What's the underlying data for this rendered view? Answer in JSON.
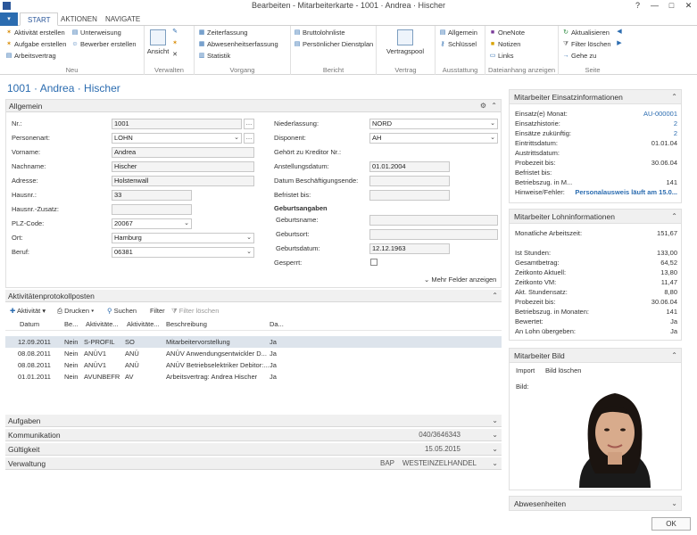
{
  "window": {
    "title": "Bearbeiten - Mitarbeiterkarte - 1001 · Andrea · Hischer",
    "help": "?",
    "minimize": "—",
    "maximize": "□",
    "close": "✕"
  },
  "tabs": [
    "START",
    "AKTIONEN",
    "NAVIGATE"
  ],
  "ribbon": {
    "neu": {
      "label": "Neu",
      "items": [
        "Aktivität erstellen",
        "Aufgabe erstellen",
        "Arbeitsvertrag",
        "Unterweisung",
        "Bewerber erstellen"
      ]
    },
    "verwalten": {
      "label": "Verwalten",
      "ansicht": "Ansicht"
    },
    "vorgang": {
      "label": "Vorgang",
      "items": [
        "Zeiterfassung",
        "Abwesenheitserfassung",
        "Statistik"
      ]
    },
    "bericht": {
      "label": "Bericht",
      "items": [
        "Bruttolohnliste",
        "Persönlicher Dienstplan"
      ]
    },
    "vertrag": {
      "label": "Vertrag",
      "vertragspool": "Vertragspool"
    },
    "ausstattung": {
      "label": "Ausstattung",
      "items": [
        "Allgemein",
        "Schlüssel"
      ]
    },
    "dateianhang": {
      "label": "Dateianhang anzeigen",
      "items": [
        "OneNote",
        "Notizen",
        "Links"
      ]
    },
    "seite": {
      "label": "Seite",
      "items": [
        "Aktualisieren",
        "Filter löschen",
        "Gehe zu"
      ]
    }
  },
  "page_title": "1001 · Andrea · Hischer",
  "allgemein": {
    "title": "Allgemein",
    "left": [
      {
        "label": "Nr.:",
        "value": "1001"
      },
      {
        "label": "Personenart:",
        "value": "LOHN"
      },
      {
        "label": "Vorname:",
        "value": "Andrea"
      },
      {
        "label": "Nachname:",
        "value": "Hischer"
      },
      {
        "label": "Adresse:",
        "value": "Holstenwall"
      },
      {
        "label": "Hausnr.:",
        "value": "33"
      },
      {
        "label": "Hausnr.-Zusatz:",
        "value": ""
      },
      {
        "label": "PLZ-Code:",
        "value": "20067"
      },
      {
        "label": "Ort:",
        "value": "Hamburg"
      },
      {
        "label": "Beruf:",
        "value": "06381"
      }
    ],
    "right": {
      "niederlassung": {
        "label": "Niederlassung:",
        "value": "NORD"
      },
      "disponent": {
        "label": "Disponent:",
        "value": "AH"
      },
      "kreditor": {
        "label": "Gehört zu Kreditor Nr.:"
      },
      "anstellung": {
        "label": "Anstellungsdatum:",
        "value": "01.01.2004"
      },
      "ende": {
        "label": "Datum Beschäftigungsende:",
        "value": ""
      },
      "befristet": {
        "label": "Befristet bis:",
        "value": ""
      },
      "geburt_head": "Geburtsangaben",
      "geburtsname": {
        "label": "Geburtsname:",
        "value": ""
      },
      "geburtsort": {
        "label": "Geburtsort:",
        "value": ""
      },
      "geburtsdatum": {
        "label": "Geburtsdatum:",
        "value": "12.12.1963"
      },
      "gesperrt": {
        "label": "Gesperrt:"
      }
    },
    "more": "Mehr Felder anzeigen"
  },
  "activities": {
    "title": "Aktivitätenprotokollposten",
    "toolbar": [
      "Aktivität",
      "Drucken",
      "Suchen",
      "Filter",
      "Filter löschen"
    ],
    "columns": [
      "Datum",
      "Be...",
      "Aktivitäte...",
      "Aktivitäte...",
      "Beschreibung",
      "Da..."
    ],
    "rows": [
      [
        "12.09.2011",
        "Nein",
        "S-PROFIL",
        "SO",
        "Mitarbeitervorstellung",
        "Ja"
      ],
      [
        "08.08.2011",
        "Nein",
        "ANÜV1",
        "ANÜ",
        "ANÜV Anwendungsentwickler D...",
        "Ja"
      ],
      [
        "08.08.2011",
        "Nein",
        "ANÜV1",
        "ANÜ",
        "ANÜV Betriebselektriker Debitor:...",
        "Ja"
      ],
      [
        "01.01.2011",
        "Nein",
        "AVUNBEFR",
        "AV",
        "Arbeitsvertrag: Andrea Hischer",
        "Ja"
      ]
    ]
  },
  "collapsed": [
    {
      "title": "Aufgaben",
      "summary": []
    },
    {
      "title": "Kommunikation",
      "summary": [
        "040/3646343"
      ]
    },
    {
      "title": "Gültigkeit",
      "summary": [
        "15.05.2015"
      ]
    },
    {
      "title": "Verwaltung",
      "summary": [
        "BAP",
        "WEST",
        "EINZELHANDEL"
      ]
    }
  ],
  "factbox_einsatz": {
    "title": "Mitarbeiter Einsatzinformationen",
    "rows": [
      {
        "k": "Einsatz(e) Monat:",
        "v": "AU-000001"
      },
      {
        "k": "Einsatzhistorie:",
        "v": "2"
      },
      {
        "k": "Einsätze zukünftig:",
        "v": "2"
      },
      {
        "k": "Eintrittsdatum:",
        "v": "01.01.04"
      },
      {
        "k": "Austrittsdatum:",
        "v": ""
      },
      {
        "k": "Probezeit bis:",
        "v": "30.06.04"
      },
      {
        "k": "Befristet bis:",
        "v": ""
      },
      {
        "k": "Betriebszug. in M...",
        "v": "141"
      },
      {
        "k": "Hinweise/Fehler:",
        "v": "Personalausweis läuft am 15.0..."
      }
    ]
  },
  "factbox_lohn": {
    "title": "Mitarbeiter Lohninformationen",
    "rows": [
      {
        "k": "Monatliche Arbeitszeit:",
        "v": "151,67"
      },
      {
        "k": "Ist Stunden:",
        "v": "133,00"
      },
      {
        "k": "Gesamtbetrag:",
        "v": "64,52"
      },
      {
        "k": "Zeitkonto Aktuell:",
        "v": "13,80"
      },
      {
        "k": "Zeitkonto VM:",
        "v": "11,47"
      },
      {
        "k": "Akt. Stundensatz:",
        "v": "8,80"
      },
      {
        "k": "Probezeit bis:",
        "v": "30.06.04"
      },
      {
        "k": "Betriebszug. in Monaten:",
        "v": "141"
      },
      {
        "k": "Bewertet:",
        "v": "Ja"
      },
      {
        "k": "An Lohn übergeben:",
        "v": "Ja"
      }
    ]
  },
  "factbox_bild": {
    "title": "Mitarbeiter Bild",
    "import": "Import",
    "delete": "Bild löschen",
    "label": "Bild:"
  },
  "factbox_abw": {
    "title": "Abwesenheiten"
  },
  "ok": "OK"
}
